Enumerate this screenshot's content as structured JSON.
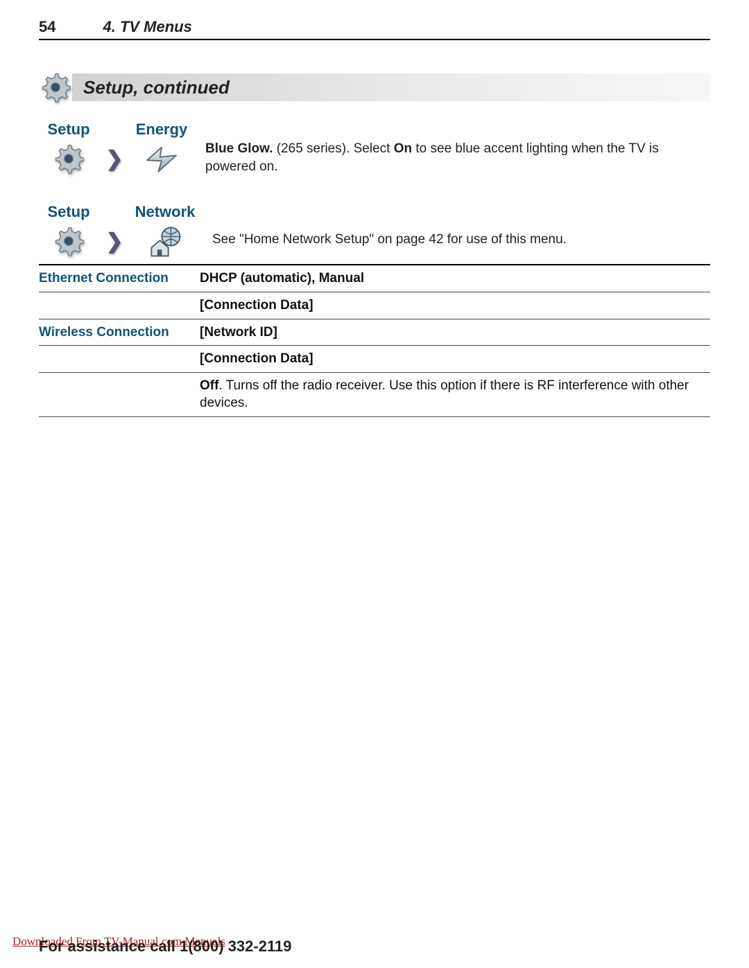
{
  "header": {
    "page_number": "54",
    "chapter": "4.  TV Menus"
  },
  "section_title": "Setup, continued",
  "energy": {
    "path_setup": "Setup",
    "path_energy": "Energy",
    "body_prefix": "Blue Glow.",
    "body_mid1": "  (265 series).  Select ",
    "body_bold": "On",
    "body_mid2": " to see blue accent lighting when the TV is powered on."
  },
  "network": {
    "path_setup": "Setup",
    "path_network": "Network",
    "intro": "See \"Home Network Setup\" on page 42 for use of this menu.",
    "rows": {
      "ethernet_label": "Ethernet Connection",
      "ethernet_val": "DHCP (automatic), Manual",
      "conn_data1": "[Connection Data]",
      "wireless_label": "Wireless Connection",
      "wireless_val": "[Network ID]",
      "conn_data2": "[Connection Data]",
      "off_bold": "Off",
      "off_rest": ".  Turns off the radio receiver.  Use this option if there is RF interference with other devices."
    }
  },
  "footer": "For assistance call 1(800) 332-2119",
  "watermark": "Downloaded From TV-Manual.com Manuals",
  "icons": {
    "gear": "gear-icon",
    "arrow": "arrow-right-icon",
    "energy": "energy-bolt-icon",
    "network": "network-globe-house-icon"
  }
}
